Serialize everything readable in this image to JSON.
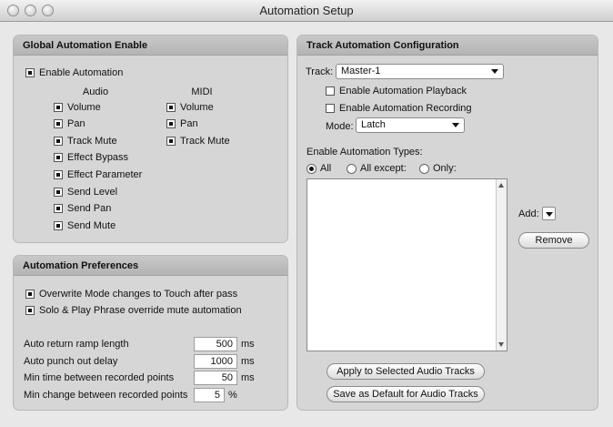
{
  "window": {
    "title": "Automation Setup"
  },
  "global": {
    "header": "Global Automation Enable",
    "enable_automation": {
      "label": "Enable Automation",
      "checked": true
    },
    "audio_header": "Audio",
    "midi_header": "MIDI",
    "audio_items": [
      {
        "label": "Volume",
        "checked": true
      },
      {
        "label": "Pan",
        "checked": true
      },
      {
        "label": "Track Mute",
        "checked": true
      },
      {
        "label": "Effect Bypass",
        "checked": true
      },
      {
        "label": "Effect Parameter",
        "checked": true
      },
      {
        "label": "Send Level",
        "checked": true
      },
      {
        "label": "Send Pan",
        "checked": true
      },
      {
        "label": "Send Mute",
        "checked": true
      }
    ],
    "midi_items": [
      {
        "label": "Volume",
        "checked": true
      },
      {
        "label": "Pan",
        "checked": true
      },
      {
        "label": "Track Mute",
        "checked": true
      }
    ]
  },
  "prefs": {
    "header": "Automation Preferences",
    "overwrite": {
      "label": "Overwrite Mode changes to Touch after pass",
      "checked": true
    },
    "solo": {
      "label": "Solo & Play Phrase override mute automation",
      "checked": true
    },
    "fields": [
      {
        "label": "Auto return ramp length",
        "value": "500",
        "unit": "ms"
      },
      {
        "label": "Auto punch out delay",
        "value": "1000",
        "unit": "ms"
      },
      {
        "label": "Min time between recorded points",
        "value": "50",
        "unit": "ms"
      },
      {
        "label": "Min change between recorded points",
        "value": "5",
        "unit": "%"
      }
    ]
  },
  "track": {
    "header": "Track Automation Configuration",
    "track_label": "Track:",
    "track_value": "Master-1",
    "playback": {
      "label": "Enable Automation Playback",
      "checked": false
    },
    "recording": {
      "label": "Enable Automation Recording",
      "checked": false
    },
    "mode_label": "Mode:",
    "mode_value": "Latch",
    "types_label": "Enable Automation Types:",
    "radios": [
      {
        "label": "All",
        "selected": true
      },
      {
        "label": "All except:",
        "selected": false
      },
      {
        "label": "Only:",
        "selected": false
      }
    ],
    "add_label": "Add:",
    "remove_label": "Remove",
    "apply_label": "Apply to Selected Audio Tracks",
    "save_label": "Save as Default for Audio Tracks"
  }
}
